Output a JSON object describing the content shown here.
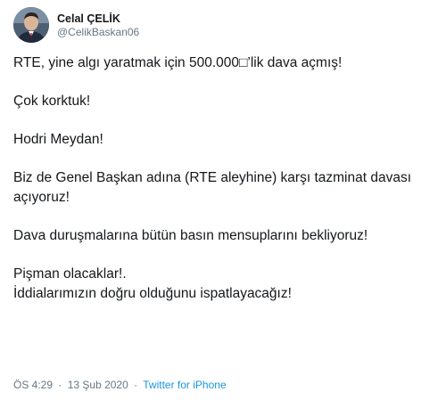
{
  "user": {
    "display_name": "Celal ÇELİK",
    "handle": "@CelikBaskan06"
  },
  "tweet": {
    "paragraphs": [
      "RTE, yine algı yaratmak için 500.000□’lik dava açmış!",
      "Çok korktuk!",
      "Hodri Meydan!",
      "Biz de Genel Başkan adına (RTE aleyhine) karşı tazminat davası açıyoruz!",
      "Dava duruşmalarına bütün basın mensuplarını bekliyoruz!",
      "Pişman olacaklar!.\nİddialarımızın doğru olduğunu ispatlayacağız!"
    ]
  },
  "meta": {
    "time": "ÖS 4:29",
    "separator": "·",
    "date": "13 Şub 2020",
    "source": "Twitter for iPhone"
  },
  "colors": {
    "text": "#14171a",
    "secondary": "#657786",
    "link": "#1b95e0"
  }
}
